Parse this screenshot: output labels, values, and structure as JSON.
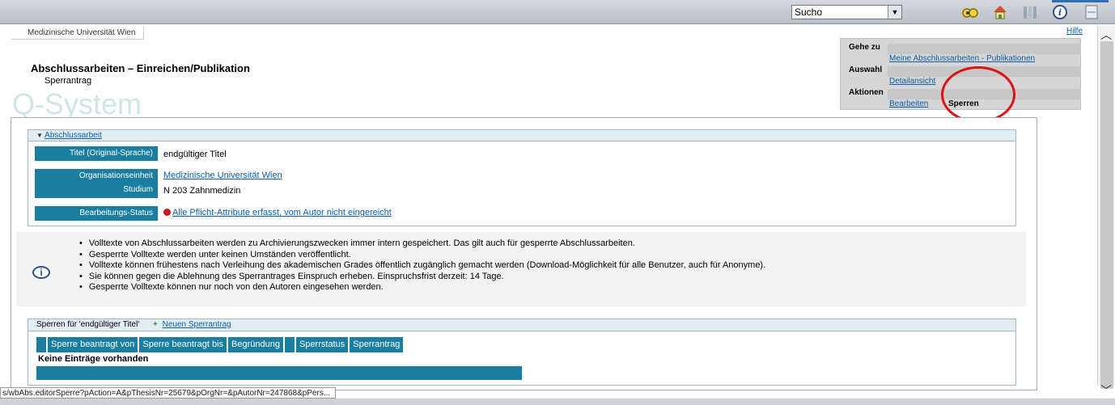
{
  "toolbar": {
    "search_value": "Sucho",
    "icons": [
      "glasses-icon",
      "home-icon",
      "library-icon",
      "info-icon",
      "language-de-en-icon"
    ]
  },
  "breadcrumb": "Medizinische Universität Wien",
  "help_label": "Hilfe",
  "title": "Abschlussarbeiten – Einreichen/Publikation",
  "subtitle": "Sperrantrag",
  "logo_text": "Q-System",
  "goto_panel": {
    "goto_label": "Gehe zu",
    "goto_link": "Meine Abschlussarbeiten - Publikationen",
    "selection_label": "Auswahl",
    "selection_link": "Detailansicht",
    "actions_label": "Aktionen",
    "edit_link": "Bearbeiten",
    "lock_label": "Sperren"
  },
  "thesis": {
    "section_title": "Abschlussarbeit",
    "title_label": "Titel (Original-Sprache)",
    "title_value": "endgültiger Titel",
    "org_label": "Organisationseinheit",
    "org_value": "Medizinische Universität Wien",
    "study_label": "Studium",
    "study_value": "N 203 Zahnmedizin",
    "status_label": "Bearbeitungs-Status",
    "status_value": "Alle Pflicht-Attribute erfasst, vom Autor nicht eingereicht"
  },
  "info": [
    "Volltexte von Abschlussarbeiten werden zu Archivierungszwecken immer intern gespeichert. Das gilt auch für gesperrte Abschlussarbeiten.",
    "Gesperrte Volltexte werden unter keinen Umständen veröffentlicht.",
    "Volltexte können frühestens nach Verleihung des akademischen Grades öffentlich zugänglich gemacht werden (Download-Möglichkeit für alle Benutzer, auch für Anonyme).",
    "Sie können gegen die Ablehnung des Sperrantrages Einspruch erheben. Einspruchsfrist derzeit: 14 Tage.",
    "Gesperrte Volltexte können nur noch von den Autoren eingesehen werden."
  ],
  "locks": {
    "header": "Sperren für 'endgültiger Titel'",
    "new_link": "Neuen Sperrantrag",
    "columns": [
      "",
      "Sperre beantragt von",
      "Sperre beantragt bis",
      "Begründung",
      "",
      "Sperrstatus",
      "Sperrantrag"
    ],
    "empty_text": "Keine Einträge vorhanden"
  },
  "status_url": "s/wbAbs.editorSperre?pAction=A&pThesisNr=25679&pOrgNr=&pAutorNr=247868&pPers..."
}
